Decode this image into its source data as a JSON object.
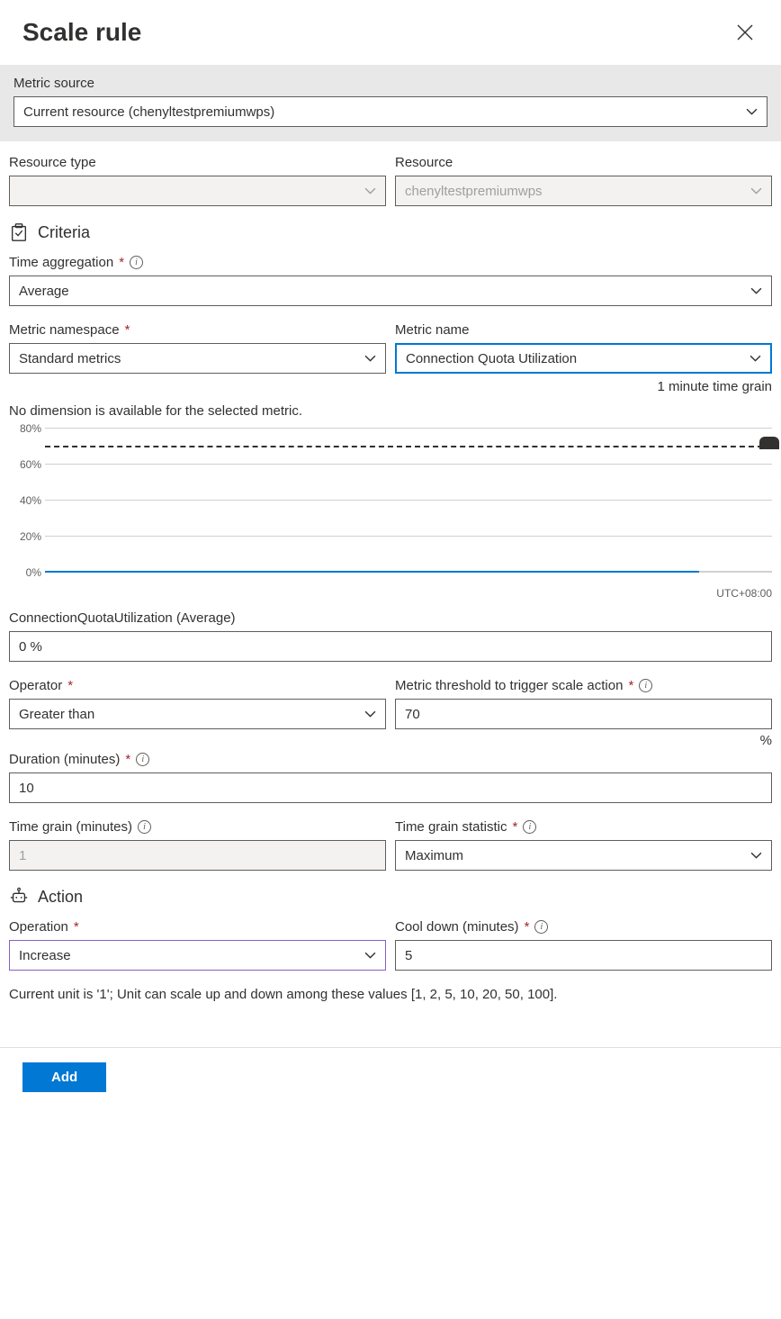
{
  "header": {
    "title": "Scale rule"
  },
  "metricSource": {
    "label": "Metric source",
    "value": "Current resource (chenyltestpremiumwps)"
  },
  "resourceType": {
    "label": "Resource type",
    "value": ""
  },
  "resource": {
    "label": "Resource",
    "value": "chenyltestpremiumwps"
  },
  "criteria": {
    "section": "Criteria",
    "timeAggregation": {
      "label": "Time aggregation",
      "value": "Average"
    },
    "metricNamespace": {
      "label": "Metric namespace",
      "value": "Standard metrics"
    },
    "metricName": {
      "label": "Metric name",
      "value": "Connection Quota Utilization",
      "grainHint": "1 minute time grain"
    },
    "noDimension": "No dimension is available for the selected metric.",
    "metricSummary": {
      "label": "ConnectionQuotaUtilization (Average)",
      "value": "0 %"
    },
    "operator": {
      "label": "Operator",
      "value": "Greater than"
    },
    "threshold": {
      "label": "Metric threshold to trigger scale action",
      "value": "70",
      "unit": "%"
    },
    "duration": {
      "label": "Duration (minutes)",
      "value": "10"
    },
    "timeGrain": {
      "label": "Time grain (minutes)",
      "value": "1"
    },
    "timeGrainStatistic": {
      "label": "Time grain statistic",
      "value": "Maximum"
    }
  },
  "action": {
    "section": "Action",
    "operation": {
      "label": "Operation",
      "value": "Increase"
    },
    "cooldown": {
      "label": "Cool down (minutes)",
      "value": "5"
    },
    "note": "Current unit is '1'; Unit can scale up and down among these values [1, 2, 5, 10, 20, 50, 100]."
  },
  "footer": {
    "addLabel": "Add"
  },
  "chart_data": {
    "type": "line",
    "title": "",
    "xlabel": "",
    "ylabel": "",
    "ylim": [
      0,
      80
    ],
    "y_ticks": [
      "80%",
      "60%",
      "40%",
      "20%",
      "0%"
    ],
    "threshold": 70,
    "series": [
      {
        "name": "ConnectionQuotaUtilization (Average)",
        "value_constant": 0,
        "x_coverage_fraction": 0.9
      }
    ],
    "spike_at_end": {
      "height_approx": 70
    },
    "timezone": "UTC+08:00"
  }
}
